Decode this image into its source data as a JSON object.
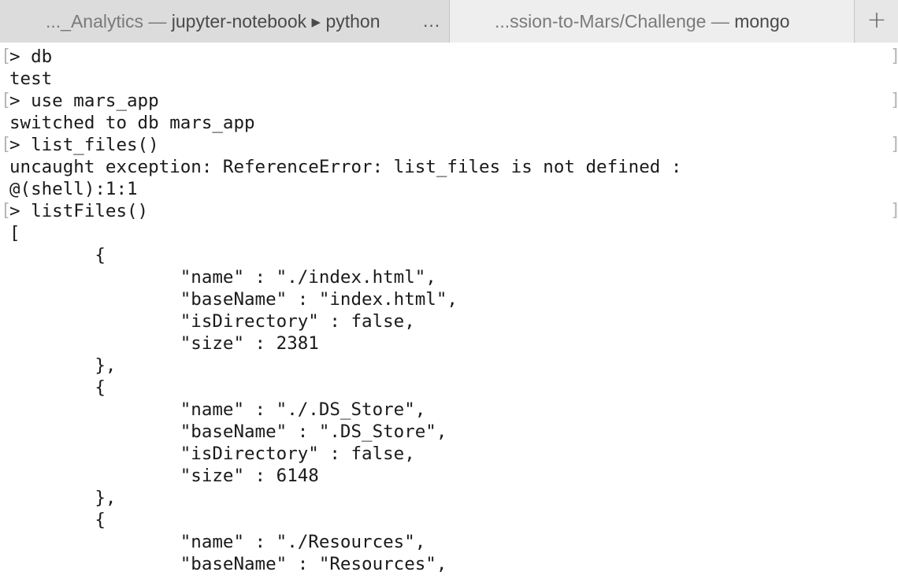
{
  "tabs": [
    {
      "prefix": "..._Analytics — ",
      "strong": "jupyter-notebook ▸ python",
      "more": "...",
      "active": false
    },
    {
      "prefix": "...ssion-to-Mars/Challenge — ",
      "strong": "mongo",
      "active": true
    }
  ],
  "new_tab_label": "+",
  "terminal": {
    "prompt_marker_open": "[",
    "prompt_marker_close": "]",
    "lines": [
      {
        "text": "> db",
        "prompt": true
      },
      {
        "text": "test",
        "prompt": false
      },
      {
        "text": "> use mars_app",
        "prompt": true
      },
      {
        "text": "switched to db mars_app",
        "prompt": false
      },
      {
        "text": "> list_files()",
        "prompt": true
      },
      {
        "text": "uncaught exception: ReferenceError: list_files is not defined :",
        "prompt": false
      },
      {
        "text": "@(shell):1:1",
        "prompt": false
      },
      {
        "text": "> listFiles()",
        "prompt": true
      },
      {
        "text": "[",
        "prompt": false
      },
      {
        "text": "        {",
        "prompt": false
      },
      {
        "text": "                \"name\" : \"./index.html\",",
        "prompt": false
      },
      {
        "text": "                \"baseName\" : \"index.html\",",
        "prompt": false
      },
      {
        "text": "                \"isDirectory\" : false,",
        "prompt": false
      },
      {
        "text": "                \"size\" : 2381",
        "prompt": false
      },
      {
        "text": "        },",
        "prompt": false
      },
      {
        "text": "        {",
        "prompt": false
      },
      {
        "text": "                \"name\" : \"./.DS_Store\",",
        "prompt": false
      },
      {
        "text": "                \"baseName\" : \".DS_Store\",",
        "prompt": false
      },
      {
        "text": "                \"isDirectory\" : false,",
        "prompt": false
      },
      {
        "text": "                \"size\" : 6148",
        "prompt": false
      },
      {
        "text": "        },",
        "prompt": false
      },
      {
        "text": "        {",
        "prompt": false
      },
      {
        "text": "                \"name\" : \"./Resources\",",
        "prompt": false
      },
      {
        "text": "                \"baseName\" : \"Resources\",",
        "prompt": false
      }
    ]
  },
  "colors": {
    "tab_inactive": "#dcdcdc",
    "tab_active": "#eeeeee",
    "terminal_bg": "#ffffff",
    "terminal_text": "#1a1a1a",
    "mark": "#b4b4b4"
  }
}
